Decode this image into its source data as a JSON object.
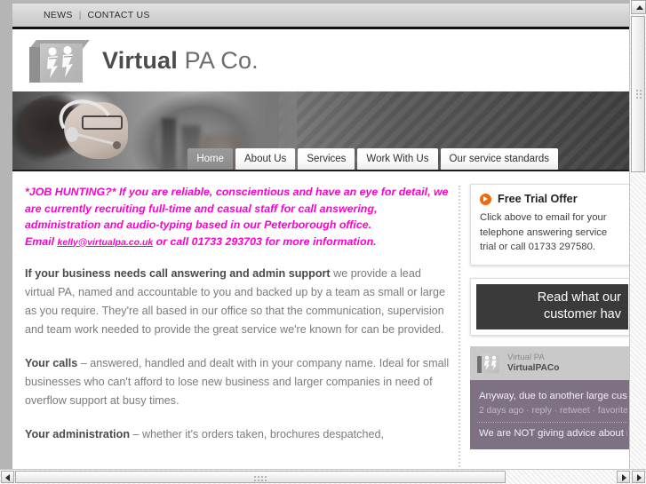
{
  "topbar": {
    "news_label": "NEWS",
    "separator": "|",
    "contact_label": "CONTACT US"
  },
  "header": {
    "brand_bold": "Virtual",
    "brand_rest": " PA Co.",
    "logo_icon": "cube-people-logo"
  },
  "nav": {
    "tabs": [
      {
        "label": "Home",
        "active": true
      },
      {
        "label": "About Us",
        "active": false
      },
      {
        "label": "Services",
        "active": false
      },
      {
        "label": "Work With Us",
        "active": false
      },
      {
        "label": "Our service standards",
        "active": false
      }
    ]
  },
  "main": {
    "job_ad": {
      "line1": "*JOB HUNTING?* If you are reliable, conscientious and have an eye for detail, we are currently recruiting full-time and casual staff for call answering, administration and audio-typing based in our Peterborough office.",
      "email_prefix": "Email ",
      "email_link": "kelly@virtualpa.co.uk",
      "email_suffix": " or call 01733 293703 for more information."
    },
    "paragraphs": [
      {
        "lead": "If your business needs call answering and admin support",
        "body": " we provide a lead virtual PA, named and accountable to you and backed up by a team as small or large as you require. They're all based in our office so that the communication, supervision and team work needed to provide the great service we're known for can be provided."
      },
      {
        "lead": "Your calls",
        "body": " – answered, handled and dealt with in your company name. Ideal for small businesses who can't afford to lose new business and larger companies in need of overflow support at busy times."
      },
      {
        "lead": "Your administration",
        "body": " – whether it's orders taken, brochures despatched,"
      }
    ]
  },
  "sidebar": {
    "free_trial": {
      "icon": "orange-arrow-icon",
      "title": "Free Trial Offer",
      "body": "Click above to email for your telephone answering service trial or call 01733 297580."
    },
    "testimonial_banner": {
      "line1": "Read what our",
      "line2": "customer hav"
    },
    "twitter": {
      "avatar_icon": "cube-people-avatar",
      "display_name": "Virtual PA",
      "handle": "VirtualPACo",
      "tweets": [
        {
          "text": "Anyway, due to another large custom again. If you want a full-time job in ou touch. Thank you.",
          "meta": "2 days ago · reply · retweet · favorite"
        },
        {
          "text": "We are NOT giving advice about ma someone, just retweeting Debrett's e how to respond when let down!",
          "meta": ""
        }
      ]
    }
  },
  "scrollbars": {
    "vertical_up_icon": "scroll-up-arrow-icon",
    "horizontal_left_icon": "scroll-left-arrow-icon",
    "horizontal_right_icon": "scroll-right-arrow-icon"
  },
  "colors": {
    "accent_magenta": "#ff00cc",
    "accent_orange": "#ef6a10",
    "twitter_purple": "#7e7183",
    "body_text": "#7b7b7b"
  }
}
